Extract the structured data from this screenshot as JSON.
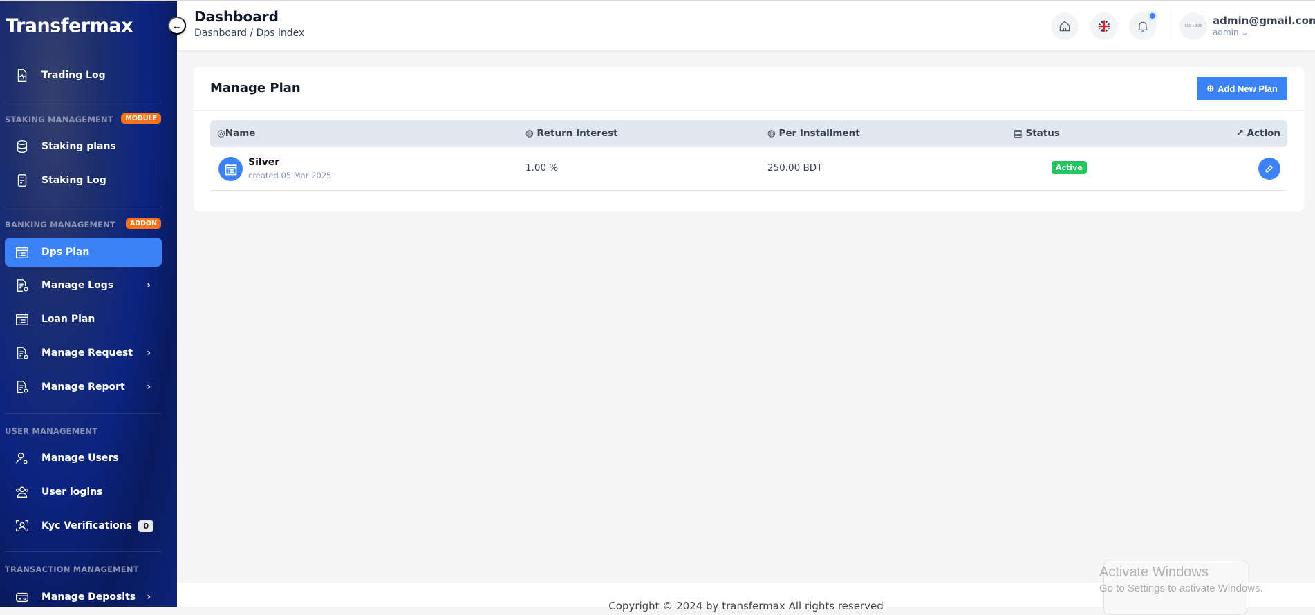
{
  "sidebar": {
    "logo": "Transfermax",
    "items": [
      {
        "label": "Trading Log",
        "icon": "file-pulse-icon"
      },
      {
        "label": "Staking plans",
        "icon": "database-icon"
      },
      {
        "label": "Staking Log",
        "icon": "document-icon"
      },
      {
        "label": "Dps Plan",
        "icon": "calendar-list-icon",
        "active": true
      },
      {
        "label": "Manage Logs",
        "icon": "file-gear-icon"
      },
      {
        "label": "Loan Plan",
        "icon": "calendar-list-icon"
      },
      {
        "label": "Manage Request",
        "icon": "file-gear-icon"
      },
      {
        "label": "Manage Report",
        "icon": "file-gear-icon"
      },
      {
        "label": "Manage Users",
        "icon": "user-gear-icon"
      },
      {
        "label": "User logins",
        "icon": "users-icon"
      },
      {
        "label": "Kyc Verifications",
        "icon": "face-scan-icon",
        "count": "0"
      },
      {
        "label": "Manage Deposits",
        "icon": "wallet-icon"
      }
    ],
    "sections": {
      "staking": "STAKING MANAGEMENT",
      "staking_badge": "MODULE",
      "banking": "BANKING MANAGEMENT",
      "banking_badge": "ADDON",
      "user": "USER MANAGEMENT",
      "transaction": "TRANSACTION MANAGEMENT"
    },
    "chevron": "›"
  },
  "header": {
    "title": "Dashboard",
    "breadcrumb": "Dashboard  / Dps index",
    "avatar_text": "100 x 100",
    "email": "admin@gmail.com",
    "role": "admin ⌄",
    "accent": "#3b82f6"
  },
  "card": {
    "title": "Manage Plan",
    "add_label": "Add New Plan",
    "columns": [
      "Name",
      "Return Interest",
      "Per Installment",
      "Status",
      "Action"
    ],
    "rows": [
      {
        "name": "Silver",
        "created": "created 05 Mar 2025",
        "interest": "1.00 %",
        "installment": "250.00 BDT",
        "status": "Active"
      }
    ]
  },
  "footer": {
    "copyright": "Copyright © 2024 by transfermax All rights reserved"
  },
  "os": {
    "watermark_title": "Activate Windows",
    "watermark_sub": "Go to Settings to activate Windows."
  }
}
